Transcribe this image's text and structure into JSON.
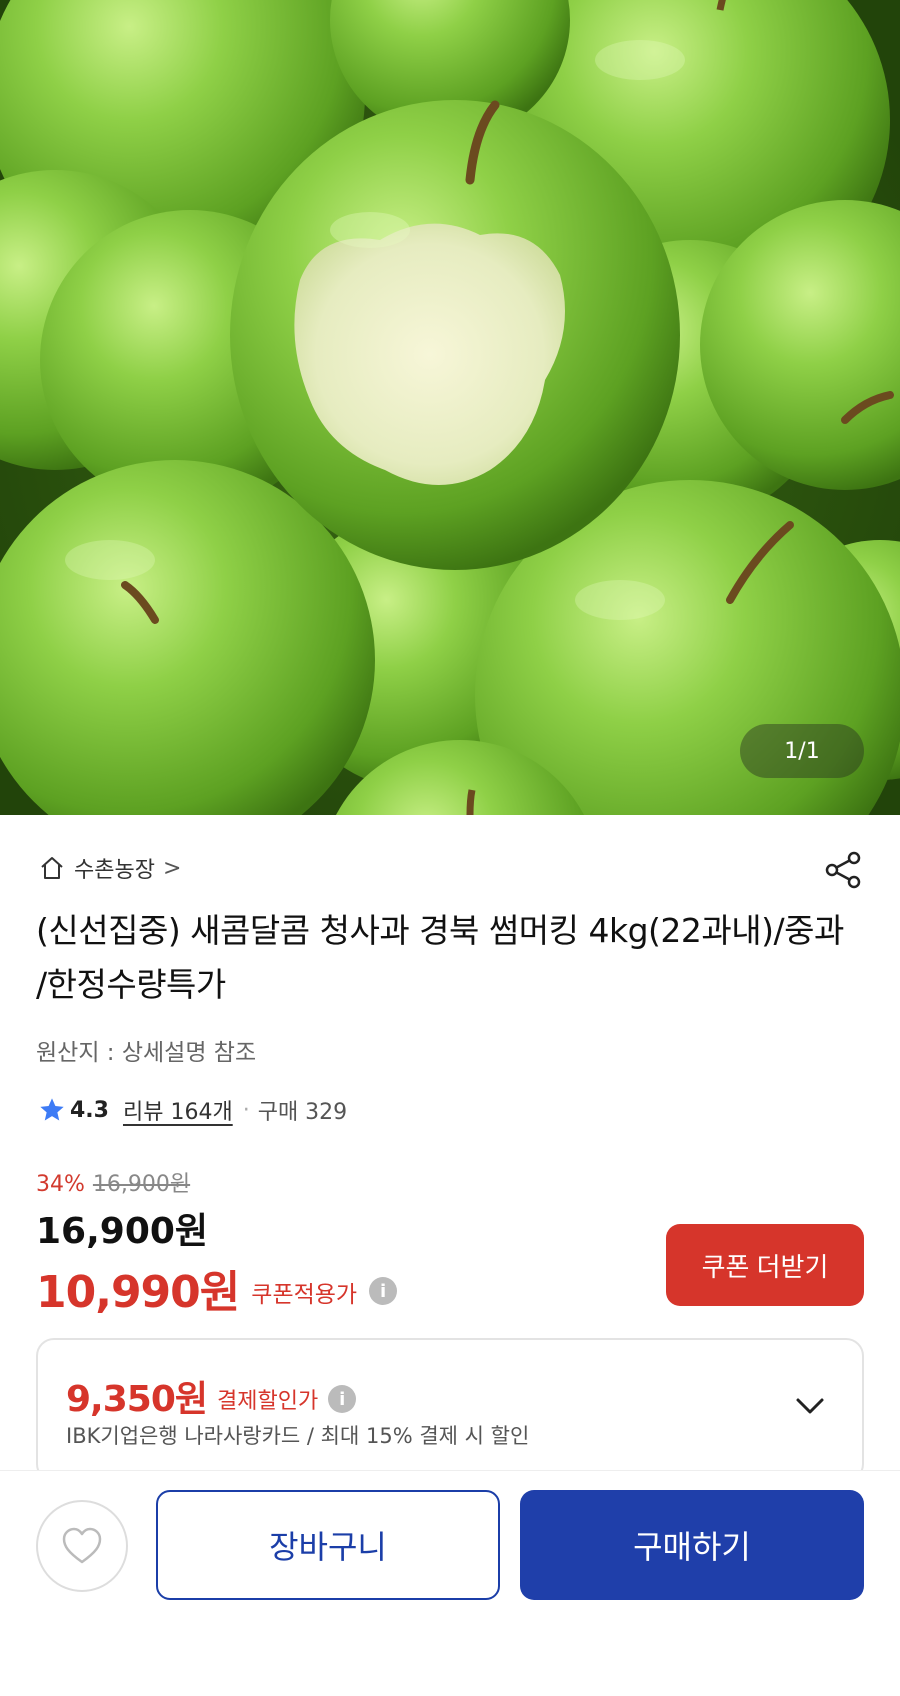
{
  "product_image": {
    "counter_text": "1/1",
    "icon": "apple-photo"
  },
  "seller": {
    "name": "수촌농장",
    "chevron": ">",
    "icon": "home-icon"
  },
  "share": {
    "icon": "share-icon"
  },
  "product": {
    "title": "(신선집중) 새콤달콤 청사과 경북 썸머킹 4kg(22과내)/중과 /한정수량특가",
    "origin": "원산지 : 상세설명 참조"
  },
  "rating": {
    "score": "4.3",
    "reviews": "리뷰 164개",
    "separator": "·",
    "purchases": "구매 329"
  },
  "price": {
    "discount_rate": "34%",
    "original": "16,900원",
    "sale": "16,900원",
    "coupon_price": "10,990원",
    "coupon_label": "쿠폰적용가",
    "info_glyph": "i"
  },
  "coupon_button": {
    "label": "쿠폰 더받기"
  },
  "payment_discount": {
    "price": "9,350원",
    "label": "결제할인가",
    "info_glyph": "i",
    "description": "IBK기업은행 나라사랑카드 / 최대 15% 결제 시 할인"
  },
  "bottom_bar": {
    "cart_label": "장바구니",
    "buy_label": "구매하기",
    "wishlist_icon": "heart-icon"
  },
  "colors": {
    "accent_red": "#d6352b",
    "primary_blue": "#1f3faa",
    "apple_green": "#7cc23a"
  }
}
